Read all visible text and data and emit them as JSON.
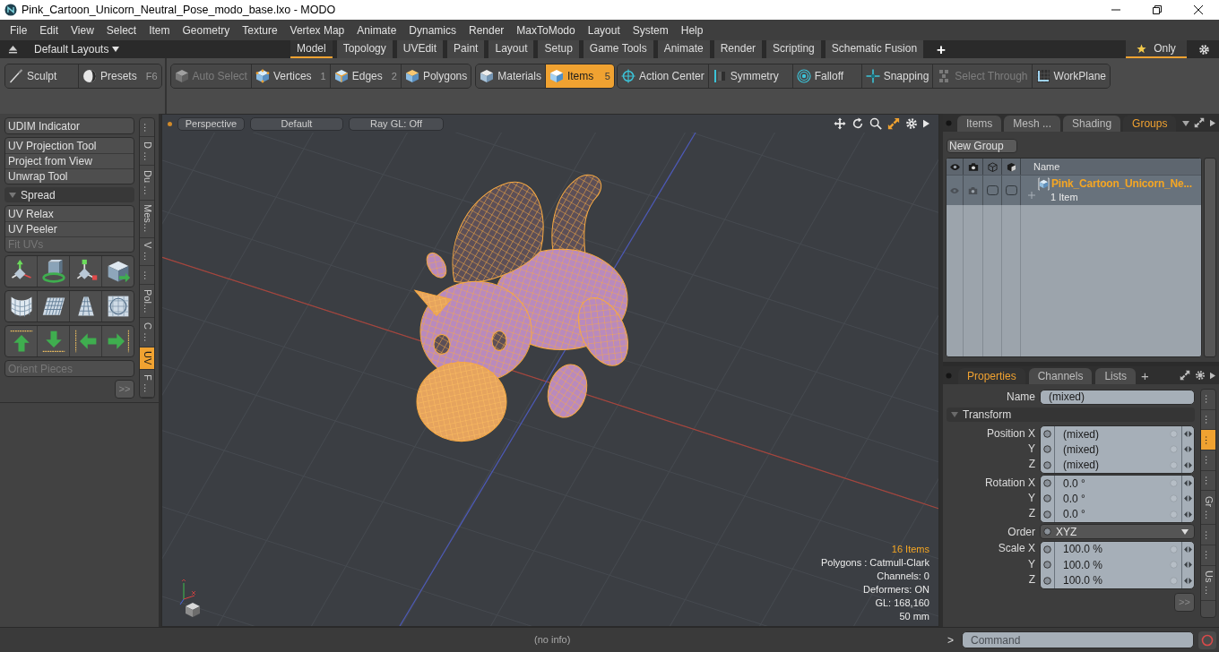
{
  "window": {
    "title": "Pink_Cartoon_Unicorn_Neutral_Pose_modo_base.lxo - MODO"
  },
  "menu": [
    "File",
    "Edit",
    "View",
    "Select",
    "Item",
    "Geometry",
    "Texture",
    "Vertex Map",
    "Animate",
    "Dynamics",
    "Render",
    "MaxToModo",
    "Layout",
    "System",
    "Help"
  ],
  "layout_bar": {
    "layouts": "Default Layouts",
    "tabs": [
      {
        "label": "Model",
        "selected": true
      },
      {
        "label": "Topology",
        "selected": false
      },
      {
        "label": "UVEdit",
        "selected": false
      },
      {
        "label": "Paint",
        "selected": false
      },
      {
        "label": "Layout",
        "selected": false
      },
      {
        "label": "Setup",
        "selected": false
      },
      {
        "label": "Game Tools",
        "selected": false
      },
      {
        "label": "Animate",
        "selected": false
      },
      {
        "label": "Render",
        "selected": false
      },
      {
        "label": "Scripting",
        "selected": false
      },
      {
        "label": "Schematic Fusion",
        "selected": false
      }
    ],
    "add": "+",
    "filter": {
      "label": "Only",
      "selected": true
    }
  },
  "toolbar": {
    "groups": [
      {
        "tools": [
          {
            "label": "Sculpt",
            "selected": false,
            "disabled": false
          },
          {
            "label": "Presets",
            "shortcut": "F6",
            "selected": false,
            "disabled": false
          }
        ]
      },
      {
        "tools": [
          {
            "label": "Auto Select",
            "selected": false,
            "disabled": true
          },
          {
            "label": "Vertices",
            "shortcut": "1",
            "selected": false,
            "disabled": false
          },
          {
            "label": "Edges",
            "shortcut": "2",
            "selected": false,
            "disabled": false
          },
          {
            "label": "Polygons",
            "selected": false,
            "disabled": false
          }
        ]
      },
      {
        "tools": [
          {
            "label": "Materials",
            "selected": false,
            "disabled": false
          },
          {
            "label": "Items",
            "shortcut": "5",
            "selected": true,
            "disabled": false
          }
        ]
      },
      {
        "tools": [
          {
            "label": "Action Center",
            "selected": false,
            "disabled": false
          },
          {
            "label": "Symmetry",
            "selected": false,
            "disabled": false
          },
          {
            "label": "Falloff",
            "selected": false,
            "disabled": false
          },
          {
            "label": "Snapping",
            "selected": false,
            "disabled": false
          },
          {
            "label": "Select Through",
            "selected": false,
            "disabled": true
          },
          {
            "label": "WorkPlane",
            "selected": false,
            "disabled": false
          }
        ]
      }
    ]
  },
  "tool_panel": {
    "groups": [
      {
        "kind": "buttons",
        "items": [
          {
            "label": "UDIM Indicator",
            "disabled": false
          }
        ]
      },
      {
        "kind": "buttons",
        "items": [
          {
            "label": "UV Projection Tool",
            "disabled": false
          },
          {
            "label": "Project from View",
            "disabled": false
          },
          {
            "label": "Unwrap Tool",
            "disabled": false
          }
        ]
      },
      {
        "kind": "section",
        "label": "Spread",
        "expanded": true
      },
      {
        "kind": "buttons",
        "items": [
          {
            "label": "UV Relax",
            "disabled": false
          },
          {
            "label": "UV Peeler",
            "disabled": false
          },
          {
            "label": "Fit UVs",
            "disabled": true
          }
        ]
      },
      {
        "kind": "icon_grid"
      },
      {
        "kind": "buttons",
        "items": [
          {
            "label": "Orient Pieces",
            "disabled": true
          }
        ]
      }
    ],
    "more": ">>",
    "side_tabs": [
      {
        "label": "…",
        "selected": false
      },
      {
        "label": "D …",
        "selected": false
      },
      {
        "label": "Du …",
        "selected": false
      },
      {
        "label": "Mes…",
        "selected": false
      },
      {
        "label": "V …",
        "selected": false
      },
      {
        "label": "…",
        "selected": false
      },
      {
        "label": "Pol…",
        "selected": false
      },
      {
        "label": "C …",
        "selected": false
      },
      {
        "label": "UV",
        "selected": true
      },
      {
        "label": "F …",
        "selected": false
      }
    ]
  },
  "viewport": {
    "buttons": [
      "Perspective",
      "Default",
      "Ray GL: Off"
    ],
    "stats": [
      {
        "text": "16 Items",
        "highlight": true
      },
      {
        "text": "Polygons : Catmull-Clark",
        "highlight": false
      },
      {
        "text": "Channels: 0",
        "highlight": false
      },
      {
        "text": "Deformers: ON",
        "highlight": false
      },
      {
        "text": "GL: 168,160",
        "highlight": false
      },
      {
        "text": "50 mm",
        "highlight": false
      }
    ]
  },
  "groups_panel": {
    "tabs": [
      {
        "label": "Items",
        "selected": false
      },
      {
        "label": "Mesh ...",
        "selected": false
      },
      {
        "label": "Shading",
        "selected": false
      },
      {
        "label": "Groups",
        "selected": true
      }
    ],
    "new_group": "New Group",
    "columns": [
      "Name"
    ],
    "rows": [
      {
        "name": "Pink_Cartoon_Unicorn_Ne...",
        "detail": "1 Item",
        "expanded": false
      }
    ]
  },
  "properties": {
    "tabs": [
      {
        "label": "Properties",
        "selected": true
      },
      {
        "label": "Channels",
        "selected": false
      },
      {
        "label": "Lists",
        "selected": false
      }
    ],
    "add": "+",
    "name": {
      "label": "Name",
      "value": "(mixed)"
    },
    "section": {
      "label": "Transform",
      "expanded": true
    },
    "fields": [
      {
        "kind": "vector",
        "rows": [
          {
            "label": "Position X",
            "value": "(mixed)"
          },
          {
            "label": "Y",
            "value": "(mixed)"
          },
          {
            "label": "Z",
            "value": "(mixed)"
          }
        ]
      },
      {
        "kind": "vector",
        "rows": [
          {
            "label": "Rotation X",
            "value": "0.0 °"
          },
          {
            "label": "Y",
            "value": "0.0 °"
          },
          {
            "label": "Z",
            "value": "0.0 °"
          }
        ]
      },
      {
        "kind": "dropdown",
        "label": "Order",
        "value": "XYZ"
      },
      {
        "kind": "vector",
        "rows": [
          {
            "label": "Scale X",
            "value": "100.0 %"
          },
          {
            "label": "Y",
            "value": "100.0 %"
          },
          {
            "label": "Z",
            "value": "100.0 %"
          }
        ]
      }
    ],
    "more": ">>",
    "side_tabs": [
      {
        "label": "…",
        "selected": false
      },
      {
        "label": "…",
        "selected": false
      },
      {
        "label": "…",
        "selected": true
      },
      {
        "label": "…",
        "selected": false
      },
      {
        "label": "…",
        "selected": false
      },
      {
        "label": "Gr …",
        "selected": false
      },
      {
        "label": "…",
        "selected": false
      },
      {
        "label": "…",
        "selected": false
      },
      {
        "label": "Us …",
        "selected": false
      }
    ]
  },
  "status_bar": {
    "info": "(no info)",
    "command": {
      "prompt": ">",
      "placeholder": "Command"
    }
  }
}
